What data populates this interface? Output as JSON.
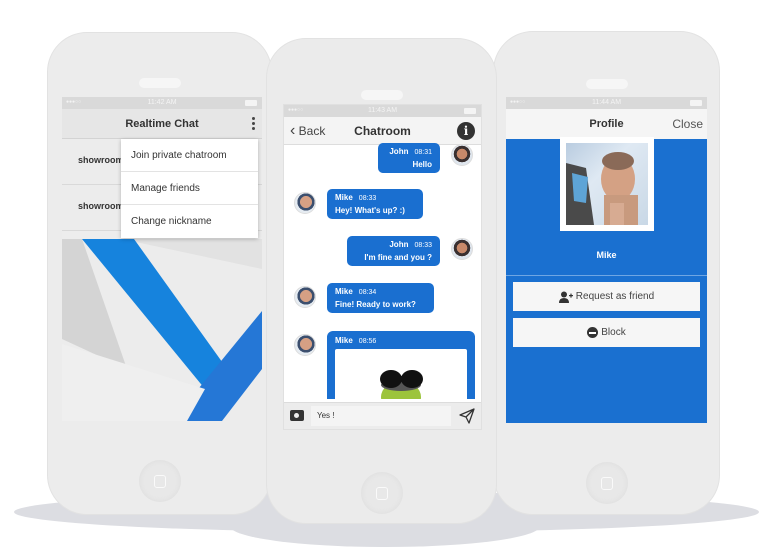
{
  "phones": {
    "left": {
      "status_time": "11:42 AM",
      "appbar_title": "Realtime Chat",
      "rooms": [
        {
          "label": "showroom"
        },
        {
          "label": "showroom"
        }
      ],
      "menu": [
        {
          "label": "Join private chatroom"
        },
        {
          "label": "Manage friends"
        },
        {
          "label": "Change nickname"
        }
      ]
    },
    "center": {
      "status_time": "11:43 AM",
      "back_label": "Back",
      "back_glyph": "‹",
      "title": "Chatroom",
      "info_glyph": "i",
      "messages": [
        {
          "sender": "John",
          "time": "08:31",
          "text": "Hello",
          "side": "right"
        },
        {
          "sender": "Mike",
          "time": "08:33",
          "text": "Hey! What's up? :)",
          "side": "left"
        },
        {
          "sender": "John",
          "time": "08:33",
          "text": "I'm fine and you ?",
          "side": "right"
        },
        {
          "sender": "Mike",
          "time": "08:34",
          "text": "Fine! Ready to work?",
          "side": "left"
        },
        {
          "sender": "Mike",
          "time": "08:56",
          "text": "",
          "side": "left",
          "attachment": "image"
        }
      ],
      "input_value": "Yes !"
    },
    "right": {
      "status_time": "11:44 AM",
      "title": "Profile",
      "close_label": "Close",
      "profile_name": "Mike",
      "buttons": [
        {
          "label": "Request as friend",
          "icon": "add-user-icon"
        },
        {
          "label": "Block",
          "icon": "block-icon"
        }
      ]
    }
  },
  "colors": {
    "accent": "#1a6fd0",
    "phone_body": "#ececec"
  }
}
